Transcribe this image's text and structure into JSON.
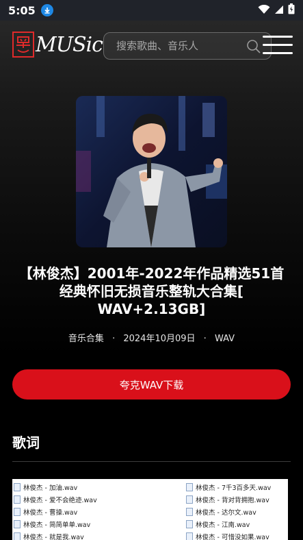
{
  "status_bar": {
    "time": "5:05"
  },
  "header": {
    "logo_text": "MUSic",
    "search_placeholder": "搜索歌曲、音乐人"
  },
  "album": {
    "title": "【林俊杰】2001年-2022年作品精选51首经典怀旧无损音乐整轨大合集[ WAV+2.13GB]",
    "title_lines": [
      "【林俊杰】2001年-2022年作品精选51首",
      "经典怀旧无损音乐整轨大合集[",
      "WAV+2.13GB]"
    ],
    "category": "音乐合集",
    "date": "2024年10月09日",
    "format": "WAV",
    "separator": "·"
  },
  "download_button": {
    "label": "夸克WAV下载"
  },
  "lyrics": {
    "heading": "歌词",
    "files_left": [
      "林俊杰 - 加油.wav",
      "林俊杰 - 爱不会绝迹.wav",
      "林俊杰 - 曹操.wav",
      "林俊杰 - 简简单单.wav",
      "林俊杰 - 就是我.wav"
    ],
    "files_right": [
      "林俊杰 - 7千3百多天.wav",
      "林俊杰 - 背对背拥抱.wav",
      "林俊杰 - 达尔文.wav",
      "林俊杰 - 江南.wav",
      "林俊杰 - 可惜没如果.wav"
    ]
  },
  "colors": {
    "accent_red": "#d9101a",
    "logo_red": "#e02a2a",
    "status_bar": "#20232a",
    "download_badge": "#1e88e5"
  }
}
